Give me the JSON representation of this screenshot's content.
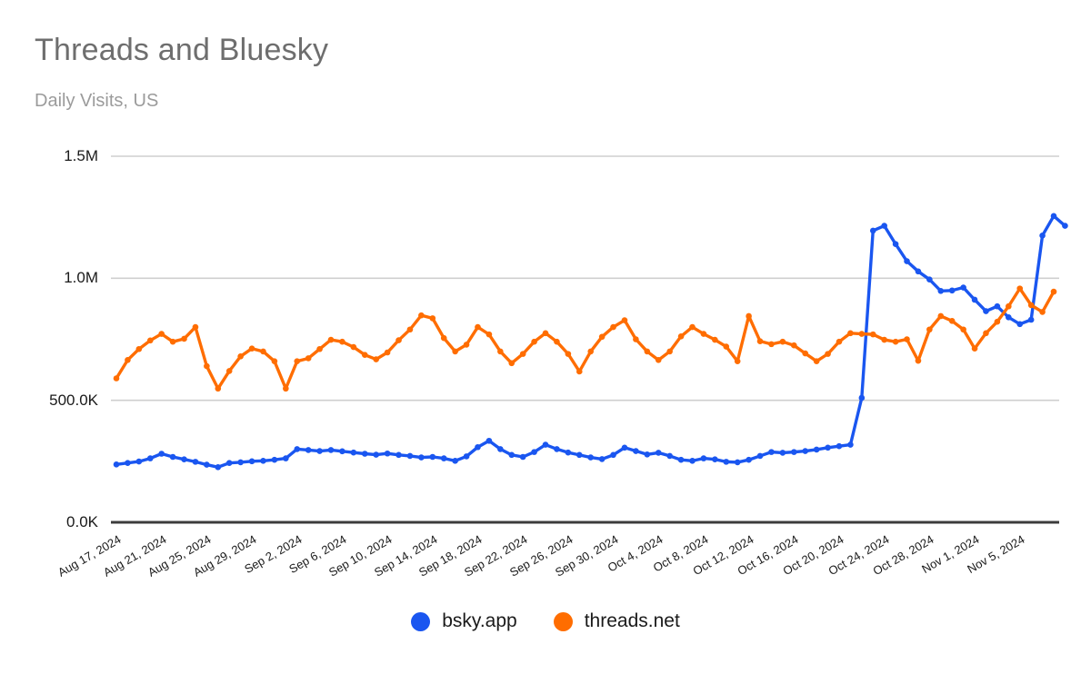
{
  "header": {
    "title": "Threads and Bluesky",
    "subtitle": "Daily Visits, US"
  },
  "legend": {
    "items": [
      {
        "label": "bsky.app",
        "color": "#1a56f0",
        "icon": "legend-dot-icon"
      },
      {
        "label": "threads.net",
        "color": "#ff6d00",
        "icon": "legend-dot-icon"
      }
    ]
  },
  "chart_data": {
    "type": "line",
    "title": "Threads and Bluesky",
    "subtitle": "Daily Visits, US",
    "xlabel": "",
    "ylabel": "",
    "grid": true,
    "legend_position": "bottom",
    "ylim": [
      0,
      1500000
    ],
    "ytick_values": [
      0,
      500000,
      1000000,
      1500000
    ],
    "ytick_labels": [
      "0.0K",
      "500.0K",
      "1.0M",
      "1.5M"
    ],
    "xtick_labels": [
      "Aug 17, 2024",
      "Aug 21, 2024",
      "Aug 25, 2024",
      "Aug 29, 2024",
      "Sep 2, 2024",
      "Sep 6, 2024",
      "Sep 10, 2024",
      "Sep 14, 2024",
      "Sep 18, 2024",
      "Sep 22, 2024",
      "Sep 26, 2024",
      "Sep 30, 2024",
      "Oct 4, 2024",
      "Oct 8, 2024",
      "Oct 12, 2024",
      "Oct 16, 2024",
      "Oct 20, 2024",
      "Oct 24, 2024",
      "Oct 28, 2024",
      "Nov 1, 2024",
      "Nov 5, 2024"
    ],
    "xtick_indices": [
      0,
      4,
      8,
      12,
      16,
      20,
      24,
      28,
      32,
      36,
      40,
      44,
      48,
      52,
      56,
      60,
      64,
      68,
      72,
      76,
      80
    ],
    "x": [
      "Aug 17, 2024",
      "Aug 18, 2024",
      "Aug 19, 2024",
      "Aug 20, 2024",
      "Aug 21, 2024",
      "Aug 22, 2024",
      "Aug 23, 2024",
      "Aug 24, 2024",
      "Aug 25, 2024",
      "Aug 26, 2024",
      "Aug 27, 2024",
      "Aug 28, 2024",
      "Aug 29, 2024",
      "Aug 30, 2024",
      "Aug 31, 2024",
      "Sep 1, 2024",
      "Sep 2, 2024",
      "Sep 3, 2024",
      "Sep 4, 2024",
      "Sep 5, 2024",
      "Sep 6, 2024",
      "Sep 7, 2024",
      "Sep 8, 2024",
      "Sep 9, 2024",
      "Sep 10, 2024",
      "Sep 11, 2024",
      "Sep 12, 2024",
      "Sep 13, 2024",
      "Sep 14, 2024",
      "Sep 15, 2024",
      "Sep 16, 2024",
      "Sep 17, 2024",
      "Sep 18, 2024",
      "Sep 19, 2024",
      "Sep 20, 2024",
      "Sep 21, 2024",
      "Sep 22, 2024",
      "Sep 23, 2024",
      "Sep 24, 2024",
      "Sep 25, 2024",
      "Sep 26, 2024",
      "Sep 27, 2024",
      "Sep 28, 2024",
      "Sep 29, 2024",
      "Sep 30, 2024",
      "Oct 1, 2024",
      "Oct 2, 2024",
      "Oct 3, 2024",
      "Oct 4, 2024",
      "Oct 5, 2024",
      "Oct 6, 2024",
      "Oct 7, 2024",
      "Oct 8, 2024",
      "Oct 9, 2024",
      "Oct 10, 2024",
      "Oct 11, 2024",
      "Oct 12, 2024",
      "Oct 13, 2024",
      "Oct 14, 2024",
      "Oct 15, 2024",
      "Oct 16, 2024",
      "Oct 17, 2024",
      "Oct 18, 2024",
      "Oct 19, 2024",
      "Oct 20, 2024",
      "Oct 21, 2024",
      "Oct 22, 2024",
      "Oct 23, 2024",
      "Oct 24, 2024",
      "Oct 25, 2024",
      "Oct 26, 2024",
      "Oct 27, 2024",
      "Oct 28, 2024",
      "Oct 29, 2024",
      "Oct 30, 2024",
      "Oct 31, 2024",
      "Nov 1, 2024",
      "Nov 2, 2024",
      "Nov 3, 2024",
      "Nov 4, 2024",
      "Nov 5, 2024",
      "Nov 6, 2024",
      "Nov 7, 2024",
      "Nov 8, 2024"
    ],
    "series": [
      {
        "name": "bsky.app",
        "color": "#1a56f0",
        "values": [
          237000,
          243000,
          249000,
          262000,
          281000,
          268000,
          258000,
          248000,
          236000,
          226000,
          243000,
          246000,
          250000,
          252000,
          256000,
          262000,
          300000,
          296000,
          292000,
          296000,
          291000,
          286000,
          281000,
          277000,
          282000,
          276000,
          272000,
          266000,
          268000,
          262000,
          252000,
          270000,
          308000,
          334000,
          300000,
          276000,
          268000,
          288000,
          318000,
          300000,
          286000,
          276000,
          266000,
          259000,
          276000,
          306000,
          292000,
          278000,
          285000,
          272000,
          256000,
          252000,
          262000,
          258000,
          248000,
          246000,
          256000,
          272000,
          288000,
          285000,
          288000,
          292000,
          298000,
          306000,
          312000,
          318000,
          510000,
          1195000,
          1215000,
          1140000,
          1070000,
          1028000,
          995000,
          948000,
          950000,
          962000,
          912000,
          865000,
          885000,
          840000,
          812000,
          830000,
          1175000,
          1255000,
          1215000
        ]
      },
      {
        "name": "threads.net",
        "color": "#ff6d00",
        "values": [
          590000,
          665000,
          710000,
          745000,
          772000,
          740000,
          752000,
          800000,
          640000,
          548000,
          620000,
          680000,
          712000,
          700000,
          660000,
          548000,
          660000,
          672000,
          710000,
          748000,
          740000,
          718000,
          686000,
          668000,
          696000,
          746000,
          790000,
          848000,
          836000,
          755000,
          700000,
          728000,
          800000,
          770000,
          700000,
          652000,
          690000,
          740000,
          775000,
          740000,
          690000,
          618000,
          700000,
          760000,
          800000,
          828000,
          750000,
          700000,
          665000,
          700000,
          762000,
          800000,
          772000,
          748000,
          720000,
          660000,
          845000,
          742000,
          730000,
          740000,
          725000,
          692000,
          660000,
          690000,
          740000,
          775000,
          772000,
          770000,
          748000,
          740000,
          750000,
          662000,
          790000,
          845000,
          825000,
          790000,
          712000,
          775000,
          822000,
          885000,
          958000,
          890000,
          862000,
          945000
        ]
      }
    ]
  }
}
